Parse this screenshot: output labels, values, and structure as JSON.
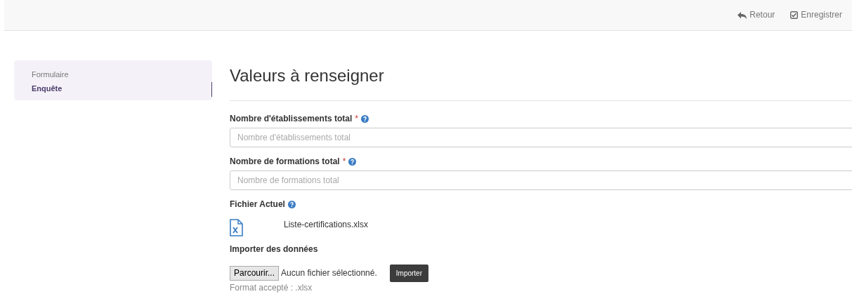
{
  "toolbar": {
    "actions": [
      {
        "label": "Retour",
        "kind": "back"
      },
      {
        "label": "Enregistrer",
        "kind": "save"
      }
    ]
  },
  "sidebar": {
    "items": [
      {
        "label": "Formulaire",
        "selected": false
      },
      {
        "label": "Enquête",
        "selected": true
      }
    ]
  },
  "heading": "Valeurs à renseigner",
  "fields": [
    {
      "label": "Nombre d'établissements total",
      "required_mark": "*",
      "help": true,
      "placeholder": "Nombre d'établissements total"
    },
    {
      "label": "Nombre de formations total",
      "required_mark": "*",
      "help": true,
      "placeholder": "Nombre de formations total"
    }
  ],
  "current_file": {
    "label": "Fichier Actuel",
    "help": true,
    "filename": "Liste-certifications.xlsx"
  },
  "import": {
    "label": "Importer des données",
    "browse_button": "Parcourir...",
    "file_status": "Aucun fichier sélectionné.",
    "submit_button": "Importer",
    "hint": "Format accepté : .xlsx"
  }
}
